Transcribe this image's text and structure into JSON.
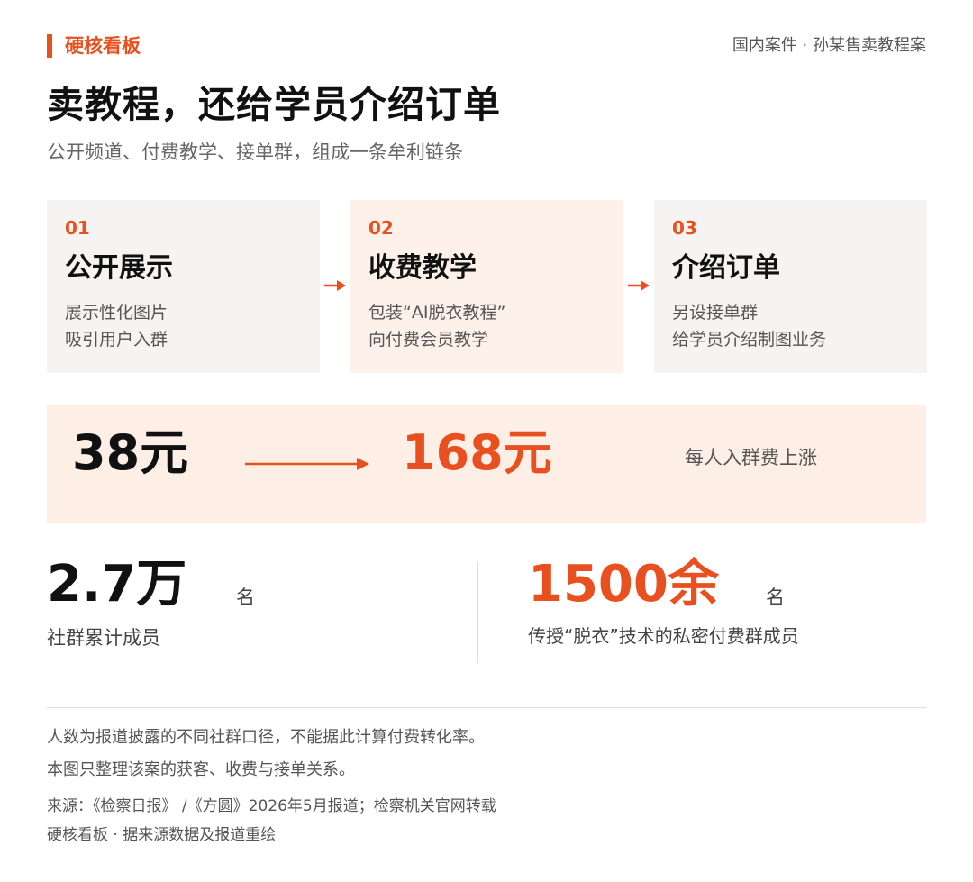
{
  "header": {
    "brand": "硬核看板",
    "case_label": "国内案件 · 孙某售卖教程案",
    "title": "卖教程，还给学员介绍订单",
    "subtitle": "公开频道、付费教学、接单群，组成一条牟利链条"
  },
  "steps": [
    {
      "num": "01",
      "title": "公开展示",
      "lines": [
        "展示性化图片",
        "吸引用户入群"
      ]
    },
    {
      "num": "02",
      "title": "收费教学",
      "lines": [
        "包装“AI脱衣教程”",
        "向付费会员教学"
      ]
    },
    {
      "num": "03",
      "title": "介绍订单",
      "lines": [
        "另设接单群",
        "给学员介绍制图业务"
      ]
    }
  ],
  "price": {
    "old": "38元",
    "new": "168元",
    "note": "每人入群费上涨"
  },
  "stats": [
    {
      "value": "2.7万",
      "unit": "名",
      "desc": "社群累计成员"
    },
    {
      "value": "1500余",
      "unit": "名",
      "desc": "传授“脱衣”技术的私密付费群成员"
    }
  ],
  "notes": [
    "人数为报道披露的不同社群口径，不能据此计算付费转化率。",
    "本图只整理该案的获客、收费与接单关系。"
  ],
  "source": "来源：《检察日报》 /《方圆》2026年5月报道；检察机关官网转载",
  "footer": "硬核看板 · 据来源数据及报道重绘",
  "colors": {
    "accent": "#e8501f",
    "card_gray": "#f5f4f2",
    "card_peach": "#fdf1ea",
    "band": "#fdeee6"
  }
}
